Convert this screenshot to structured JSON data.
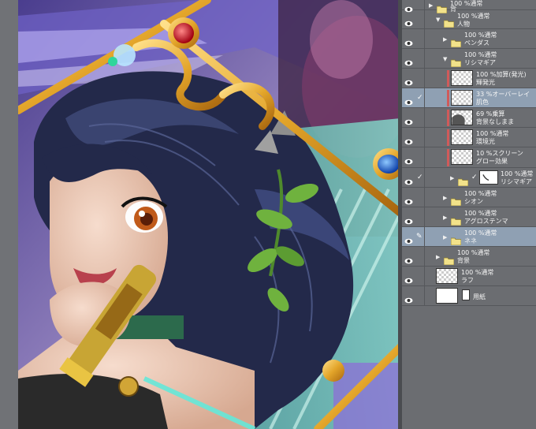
{
  "layers": [
    {
      "id": "bg-top",
      "depth": 0,
      "kind": "folder",
      "line1": "100 %通常",
      "line2": "背",
      "selected": false
    },
    {
      "id": "jinbutsu",
      "depth": 1,
      "kind": "folder",
      "expanded": true,
      "line1": "100 %通常",
      "line2": "人物",
      "selected": false
    },
    {
      "id": "pendas",
      "depth": 2,
      "kind": "folder",
      "line1": "100 %通常",
      "line2": "ペンダス",
      "selected": false
    },
    {
      "id": "rishimagia",
      "depth": 2,
      "kind": "folder",
      "expanded": true,
      "line1": "100 %通常",
      "line2": "リシマギア",
      "selected": false
    },
    {
      "id": "hakko",
      "depth": 3,
      "kind": "layer",
      "line1": "100 %加算(発光)",
      "line2": "輝発光",
      "selected": false
    },
    {
      "id": "hadairo",
      "depth": 3,
      "kind": "layer",
      "line1": "33 %オーバーレイ",
      "line2": "肌色",
      "selected": true,
      "check": true
    },
    {
      "id": "haikei-nashi",
      "depth": 3,
      "kind": "layer",
      "line1": "69 %乗算",
      "line2": "背景なしまま",
      "selected": false,
      "dark_thumb": true
    },
    {
      "id": "kankyoko",
      "depth": 3,
      "kind": "layer",
      "line1": "100 %通常",
      "line2": "環境光",
      "selected": false
    },
    {
      "id": "glow",
      "depth": 3,
      "kind": "layer",
      "line1": "10 %スクリーン",
      "line2": "グロー効果",
      "selected": false
    },
    {
      "id": "rishimagia-inner",
      "depth": 3,
      "kind": "folder-mask",
      "line1": "100 %通常",
      "line2": "リシマギア",
      "selected": false,
      "check": true
    },
    {
      "id": "shion",
      "depth": 2,
      "kind": "folder",
      "line1": "100 %通常",
      "line2": "シオン",
      "selected": false
    },
    {
      "id": "agrostemma",
      "depth": 2,
      "kind": "folder",
      "line1": "100 %通常",
      "line2": "アグロステンマ",
      "selected": false
    },
    {
      "id": "nene",
      "depth": 2,
      "kind": "folder",
      "line1": "100 %通常",
      "line2": "ネネ",
      "selected": true,
      "pen": true
    },
    {
      "id": "haikei",
      "depth": 1,
      "kind": "folder",
      "line1": "100 %通常",
      "line2": "背景",
      "selected": false
    },
    {
      "id": "rafu",
      "depth": 1,
      "kind": "layer",
      "line1": "100 %通常",
      "line2": "ラフ",
      "selected": false
    },
    {
      "id": "yoshi",
      "depth": 1,
      "kind": "paper",
      "line1": "",
      "line2": "用紙",
      "selected": false
    }
  ]
}
